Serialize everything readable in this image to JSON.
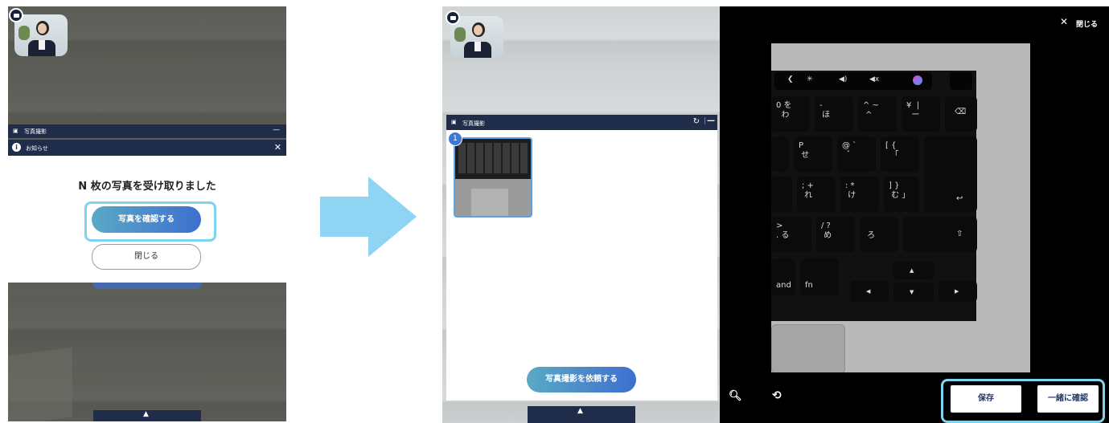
{
  "left": {
    "panel_title": "写真撮影",
    "notice_title": "お知らせ",
    "close_x": "✕",
    "message": "N 枚の写真を受け取りました",
    "confirm_button": "写真を確認する",
    "close_button": "閉じる"
  },
  "right": {
    "panel_title": "写真撮影",
    "photo_number": "1",
    "request_button": "写真撮影を依頼する",
    "viewer_close": "閉じる",
    "save_button": "保存",
    "confirm_together_button": "一緒に確認",
    "keyboard_keys": {
      "zero": "0 を\n  わ",
      "minus": "-\n ほ",
      "caret": "^ ~\n ^",
      "yen": "¥  |\n  ー",
      "p": "P\n せ",
      "at": "@ `\n  ゛",
      "bracket": "[ {\n  「",
      "plus": "; +\n れ",
      "colon": ": *\n け",
      "rbracket": "] }\n む 」",
      "gt": "> \n. る",
      "question": "/ ?\n め",
      "ro": "\n ろ",
      "fn": "fn",
      "and": "and"
    },
    "accent_colors": {
      "navy": "#1f2d4b",
      "highlight": "#7fd3ee",
      "button_blue": "#3e6fcf"
    }
  }
}
